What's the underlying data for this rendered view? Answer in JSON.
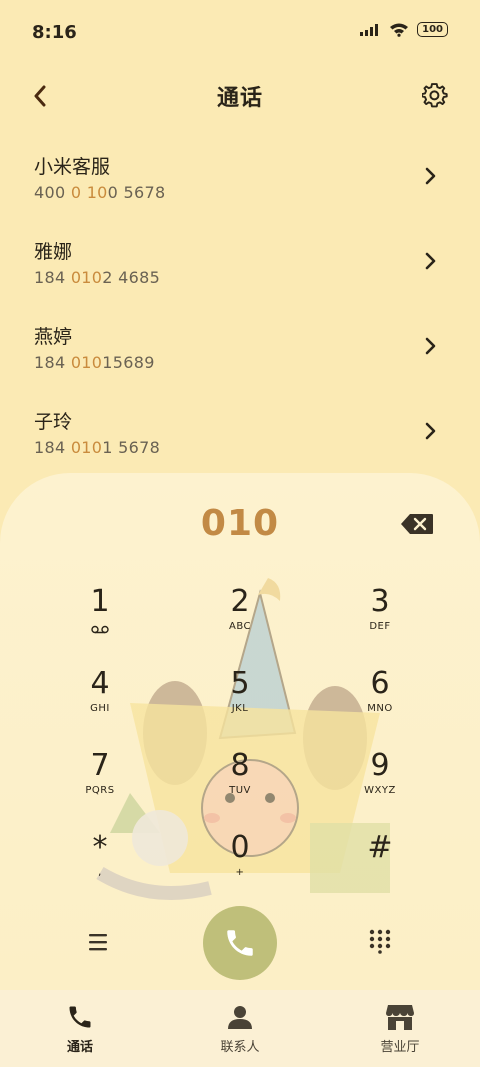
{
  "status": {
    "time": "8:16",
    "battery": "100"
  },
  "header": {
    "title": "通话"
  },
  "contacts": [
    {
      "name": "小米客服",
      "num_pre": "400 ",
      "num_hl": "0",
      "num_mid": " ",
      "num_hl2": "10",
      "num_post": "0 5678"
    },
    {
      "name": "雅娜",
      "num_pre": "184 ",
      "num_hl": "010",
      "num_mid": "",
      "num_hl2": "",
      "num_post": "2 4685"
    },
    {
      "name": "燕婷",
      "num_pre": "184 ",
      "num_hl": "010",
      "num_mid": "",
      "num_hl2": "",
      "num_post": "15689"
    },
    {
      "name": "子玲",
      "num_pre": "184 ",
      "num_hl": "010",
      "num_mid": "",
      "num_hl2": "",
      "num_post": "1 5678"
    }
  ],
  "dialer": {
    "input": "010",
    "keys": [
      {
        "digit": "1",
        "letters": ""
      },
      {
        "digit": "2",
        "letters": "ABC"
      },
      {
        "digit": "3",
        "letters": "DEF"
      },
      {
        "digit": "4",
        "letters": "GHI"
      },
      {
        "digit": "5",
        "letters": "JKL"
      },
      {
        "digit": "6",
        "letters": "MNO"
      },
      {
        "digit": "7",
        "letters": "PQRS"
      },
      {
        "digit": "8",
        "letters": "TUV"
      },
      {
        "digit": "9",
        "letters": "WXYZ"
      },
      {
        "digit": "*",
        "letters": ","
      },
      {
        "digit": "0",
        "letters": "+"
      },
      {
        "digit": "#",
        "letters": ""
      }
    ]
  },
  "nav": [
    {
      "label": "通话",
      "icon": "phone-icon",
      "active": true
    },
    {
      "label": "联系人",
      "icon": "person-icon",
      "active": false
    },
    {
      "label": "营业厅",
      "icon": "store-icon",
      "active": false
    }
  ],
  "colors": {
    "background": "#fbeab4",
    "accent": "#c28a45",
    "call_button": "#bfbf7a"
  }
}
